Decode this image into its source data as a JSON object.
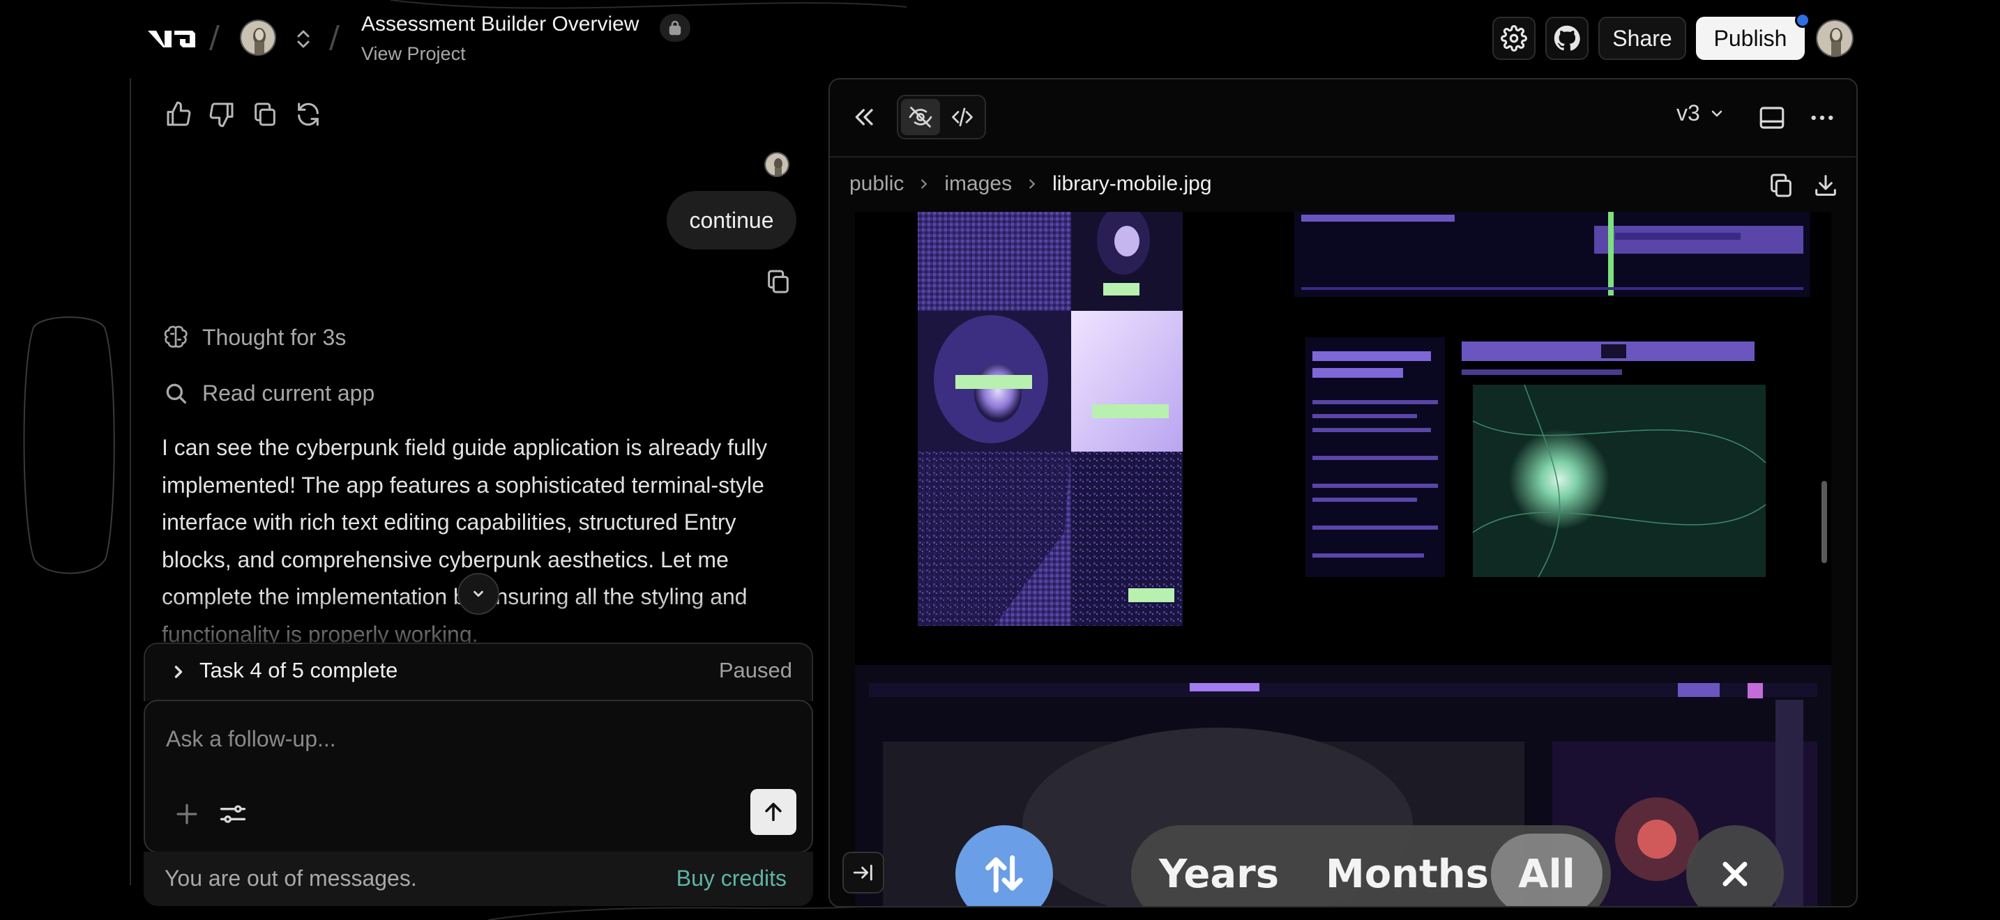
{
  "header": {
    "project_title": "Assessment Builder Overview",
    "project_sub": "View Project",
    "share_label": "Share",
    "publish_label": "Publish",
    "separator": "/"
  },
  "chat": {
    "user_message": "continue",
    "thought_label": "Thought for 3s",
    "read_label": "Read current app",
    "assistant_message": "I can see the cyberpunk field guide application is already fully implemented! The app features a sophisticated terminal-style interface with rich text editing capabilities, structured Entry blocks, and comprehensive cyberpunk aesthetics. Let me complete the implementation by ensuring all the styling and functionality is properly working.",
    "task_label": "Task 4 of 5 complete",
    "task_status": "Paused",
    "input_placeholder": "Ask a follow-up...",
    "out_of_messages": "You are out of messages.",
    "buy_credits": "Buy credits"
  },
  "preview": {
    "version": "v3",
    "breadcrumb": [
      "public",
      "images",
      "library-mobile.jpg"
    ],
    "overlay": {
      "options": [
        "Years",
        "Months",
        "All"
      ],
      "selected": "All"
    }
  },
  "colors": {
    "accent_link": "#5fb4a6",
    "publish_dot": "#2f6fe6",
    "sort_button": "#6a9ee6",
    "image_purple": "#6b4fc6"
  }
}
